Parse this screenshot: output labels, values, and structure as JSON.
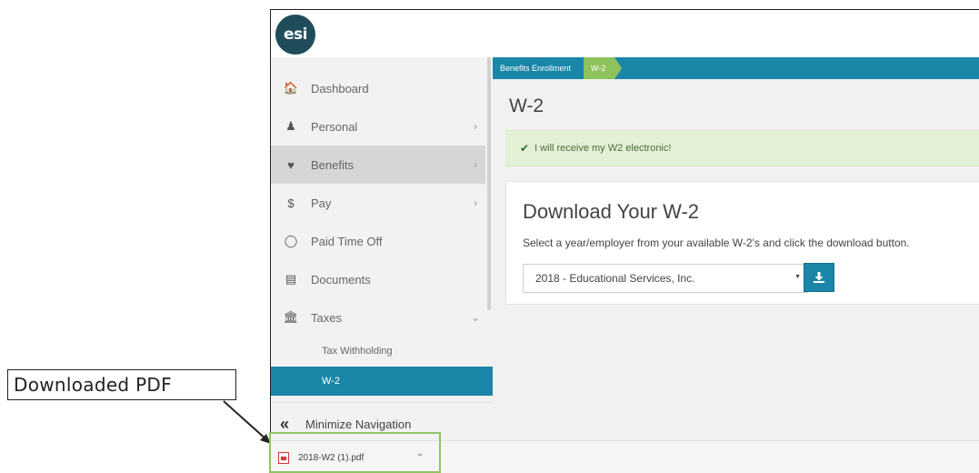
{
  "callout": {
    "label": "Downloaded PDF"
  },
  "logo": {
    "text": "esi"
  },
  "breadcrumb": {
    "items": [
      "Benefits Enrollment",
      "W-2"
    ]
  },
  "sidebar": {
    "items": [
      {
        "label": "Dashboard",
        "icon": "home-icon",
        "glyph": "⌂"
      },
      {
        "label": "Personal",
        "icon": "user-icon",
        "glyph": "♟"
      },
      {
        "label": "Benefits",
        "icon": "heartbeat-icon",
        "glyph": "♥"
      },
      {
        "label": "Pay",
        "icon": "dollar-icon",
        "glyph": "$"
      },
      {
        "label": "Paid Time Off",
        "icon": "clock-icon",
        "glyph": "◷"
      },
      {
        "label": "Documents",
        "icon": "document-icon",
        "glyph": "▤"
      },
      {
        "label": "Taxes",
        "icon": "bank-icon",
        "glyph": "⌂"
      }
    ],
    "sub_items": [
      "Tax Withholding",
      "W-2"
    ],
    "minimize_label": "Minimize Navigation"
  },
  "main": {
    "title": "W-2",
    "alert": "I will receive my W2 electronic!",
    "card": {
      "title": "Download Your W-2",
      "description": "Select a year/employer from your available W-2's and click the download button.",
      "select_value": "2018 - Educational Services, Inc."
    }
  },
  "download_bar": {
    "file_name": "2018-W2 (1).pdf"
  },
  "colors": {
    "accent": "#1a86a8",
    "breadcrumb_current": "#8ec25c",
    "alert_bg": "#e3f0d6",
    "logo_bg": "#1f4c5b"
  }
}
